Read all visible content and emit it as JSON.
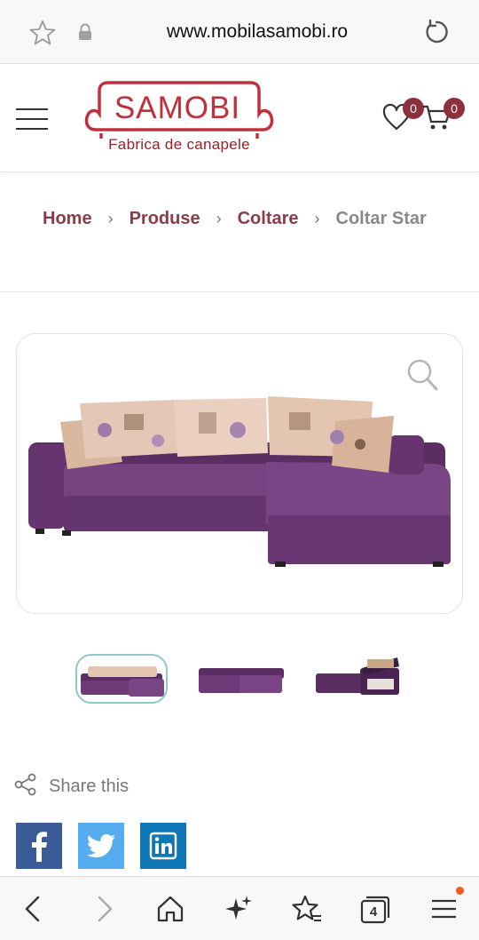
{
  "browser": {
    "url": "www.mobilasamobi.ro",
    "tab_count": "4"
  },
  "header": {
    "logo_title": "SAMOBI",
    "logo_subtitle": "Fabrica de canapele",
    "wishlist_count": "0",
    "cart_count": "0"
  },
  "breadcrumb": {
    "items": [
      "Home",
      "Produse",
      "Coltare"
    ],
    "separator": "›",
    "current": "Coltar Star"
  },
  "product": {
    "thumbnails": [
      "sofa-front-view",
      "sofa-opened-bed",
      "sofa-storage-open"
    ],
    "selected_thumbnail": 1
  },
  "share": {
    "label": "Share this",
    "networks": [
      "facebook",
      "twitter",
      "linkedin"
    ]
  },
  "icons": {
    "favorite": "star-icon",
    "secure": "lock-icon",
    "reload": "reload-icon",
    "menu": "hamburger-icon",
    "wishlist": "heart-icon",
    "cart": "cart-icon",
    "zoom": "search-icon"
  },
  "colors": {
    "brand": "#c0303a",
    "breadcrumb_link": "#8b3b4a",
    "badge": "#8e2f3c",
    "facebook": "#3b5a98",
    "twitter": "#55acee",
    "linkedin": "#0f77b5",
    "notification_dot": "#f25a1e"
  }
}
